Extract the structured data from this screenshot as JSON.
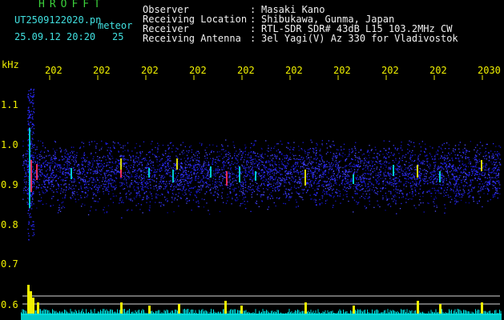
{
  "app": {
    "title": "HROFFT"
  },
  "file": {
    "name": "UT2509122020.pn",
    "tag": "meteor"
  },
  "timestamp": {
    "date_time": "25.09.12 20:20",
    "count": "25"
  },
  "info": {
    "labels": [
      "Observer",
      "Receiving Location",
      "Receiver",
      "Receiving Antenna"
    ],
    "separators": [
      ":",
      ":",
      ":",
      ":"
    ],
    "values": [
      "Masaki Kano",
      "Shibukawa, Gunma, Japan",
      "RTL-SDR SDR# 43dB L15 103.2MHz CW",
      "3el Yagi(V) Az 330 for Vladivostok"
    ]
  },
  "axis": {
    "unit": "kHz",
    "y_ticks": [
      "1.1",
      "1.0",
      "0.9",
      "0.8",
      "0.7",
      "0.6"
    ],
    "x_ticks": [
      "202",
      "202",
      "202",
      "202",
      "202",
      "202",
      "202",
      "202",
      "202",
      "2030"
    ]
  },
  "colors": {
    "header_green": "#3bd13b",
    "header_cyan": "#41e0e0",
    "axis_yellow": "#f0f000",
    "spectrum_blue": "#1a1aff",
    "signal_cyan": "#00e0e0"
  }
}
